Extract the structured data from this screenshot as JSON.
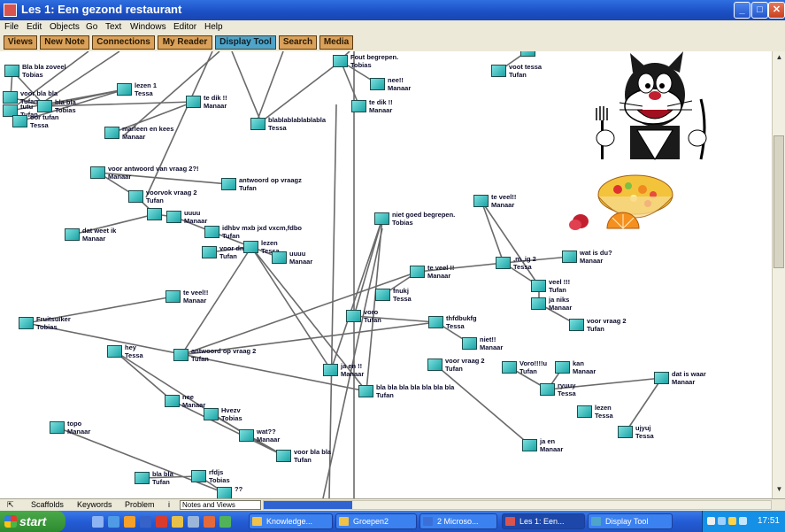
{
  "window": {
    "title": "Les 1: Een gezond restaurant",
    "buttons": {
      "minimize": "_",
      "maximize": "□",
      "close": "✕"
    }
  },
  "menu": [
    "File",
    "Edit",
    "Objects",
    "Go",
    "Text",
    "Windows",
    "Editor",
    "Help"
  ],
  "tools": [
    {
      "label": "Views",
      "active": false
    },
    {
      "label": "New Note",
      "active": false
    },
    {
      "label": "Connections",
      "active": false
    },
    {
      "label": "My Reader",
      "active": false
    },
    {
      "label": "Display Tool",
      "active": true
    },
    {
      "label": "Search",
      "active": false
    },
    {
      "label": "Media",
      "active": false
    }
  ],
  "notes": [
    {
      "id": "n1",
      "lines": [
        "Bla bla zoveel",
        "Tobias"
      ]
    },
    {
      "id": "n2",
      "lines": [
        "voor bla bla",
        "Tufan"
      ]
    },
    {
      "id": "n3",
      "lines": [
        "tutu",
        "Tufan"
      ]
    },
    {
      "id": "n4",
      "lines": [
        "bla bla",
        "Tobias"
      ]
    },
    {
      "id": "n5",
      "lines": [
        "oor tufan",
        "Tessa"
      ]
    },
    {
      "id": "n6",
      "lines": [
        "lezen 1",
        "Tessa"
      ]
    },
    {
      "id": "n7",
      "lines": [
        "te dik !!",
        "Manaar"
      ]
    },
    {
      "id": "n8",
      "lines": [
        "marleen en kees",
        "Manaar"
      ]
    },
    {
      "id": "n9",
      "lines": [
        "blablablablablabla",
        "Tessa"
      ]
    },
    {
      "id": "n10",
      "lines": [
        "Fout begrepen.",
        "Tobias"
      ]
    },
    {
      "id": "n11",
      "lines": [
        "nee!!",
        "Manaar"
      ]
    },
    {
      "id": "n12",
      "lines": [
        "te dik !!",
        "Manaar"
      ]
    },
    {
      "id": "n13",
      "lines": [
        "voot tessa",
        "Tufan"
      ]
    },
    {
      "id": "n14",
      "lines": [
        "",
        "Tessa"
      ]
    },
    {
      "id": "n15",
      "lines": [
        "voor antwoord van vraag 2?!",
        "Manaar"
      ]
    },
    {
      "id": "n16",
      "lines": [
        "antwoord op vraagz",
        "Tufan"
      ]
    },
    {
      "id": "n17",
      "lines": [
        "voorvok vraag 2",
        "Tufan"
      ]
    },
    {
      "id": "n18",
      "lines": [
        "dat weet ik",
        "Manaar"
      ]
    },
    {
      "id": "n19",
      "lines": [
        "",
        ""
      ]
    },
    {
      "id": "n20",
      "lines": [
        "uuuu",
        "Manaar"
      ]
    },
    {
      "id": "n21",
      "lines": [
        "idhbv mxb jxd vxcm,fdbo",
        "Tufan"
      ]
    },
    {
      "id": "n22",
      "lines": [
        "voor dm",
        "Tufan"
      ]
    },
    {
      "id": "n23",
      "lines": [
        "lezen",
        "Tessa"
      ]
    },
    {
      "id": "n24",
      "lines": [
        "uuuu",
        "Manaar"
      ]
    },
    {
      "id": "n25",
      "lines": [
        "niet goed begrepen.",
        "Tobias"
      ]
    },
    {
      "id": "n26",
      "lines": [
        "te veel!!",
        "Manaar"
      ]
    },
    {
      "id": "n27",
      "lines": [
        "wat is du?",
        "Manaar"
      ]
    },
    {
      "id": "n28",
      "lines": [
        ",m.,ig 2",
        "Tessa"
      ]
    },
    {
      "id": "n29",
      "lines": [
        "te veel !!",
        "Manaar"
      ]
    },
    {
      "id": "n30",
      "lines": [
        "veel !!!",
        "Tufan"
      ]
    },
    {
      "id": "n31",
      "lines": [
        "ja niks",
        "Manaar"
      ]
    },
    {
      "id": "n32",
      "lines": [
        "voor vraag 2",
        "Tufan"
      ]
    },
    {
      "id": "n33",
      "lines": [
        "te veel!!",
        "Manaar"
      ]
    },
    {
      "id": "n34",
      "lines": [
        "fnukj",
        "Tessa"
      ]
    },
    {
      "id": "n35",
      "lines": [
        "Fruitsuiker",
        "Tobias"
      ]
    },
    {
      "id": "n36",
      "lines": [
        "voro",
        "Tufan"
      ]
    },
    {
      "id": "n37",
      "lines": [
        "thfdbukfg",
        "Tessa"
      ]
    },
    {
      "id": "n38",
      "lines": [
        "niet!!",
        "Manaar"
      ]
    },
    {
      "id": "n39",
      "lines": [
        "hey",
        "Tessa"
      ]
    },
    {
      "id": "n40",
      "lines": [
        "antwoord op vraag 2",
        "Tufan"
      ]
    },
    {
      "id": "n41",
      "lines": [
        "voor vraag 2",
        "Tufan"
      ]
    },
    {
      "id": "n42",
      "lines": [
        "Voro!!!!u",
        "Tufan"
      ]
    },
    {
      "id": "n43",
      "lines": [
        "kan",
        "Manaar"
      ]
    },
    {
      "id": "n44",
      "lines": [
        "dat is waar",
        "Manaar"
      ]
    },
    {
      "id": "n45",
      "lines": [
        "ja  en !!",
        "Manaar"
      ]
    },
    {
      "id": "n46",
      "lines": [
        "bla bla bla bla bla bla bla",
        "Tufan"
      ]
    },
    {
      "id": "n47",
      "lines": [
        "ryuuy",
        "Tessa"
      ]
    },
    {
      "id": "n48",
      "lines": [
        "nee",
        "Manaar"
      ]
    },
    {
      "id": "n49",
      "lines": [
        "Hvezv",
        "Tobias"
      ]
    },
    {
      "id": "n50",
      "lines": [
        "lezen",
        "Tessa"
      ]
    },
    {
      "id": "n51",
      "lines": [
        "topo",
        "Manaar"
      ]
    },
    {
      "id": "n52",
      "lines": [
        "wat??",
        "Manaar"
      ]
    },
    {
      "id": "n53",
      "lines": [
        "ujyuj",
        "Tessa"
      ]
    },
    {
      "id": "n54",
      "lines": [
        "ja en",
        "Manaar"
      ]
    },
    {
      "id": "n55",
      "lines": [
        "voor bla bla",
        "Tufan"
      ]
    },
    {
      "id": "n56",
      "lines": [
        "bla bla",
        "Tufan"
      ]
    },
    {
      "id": "n57",
      "lines": [
        "rfdjs",
        "Tobias"
      ]
    },
    {
      "id": "n58",
      "lines": [
        "??",
        ""
      ]
    }
  ],
  "bottom_tabs": [
    "Scaffolds",
    "Keywords",
    "Problem",
    "i"
  ],
  "views_select": "Notes and Views",
  "taskbar": {
    "start": "start",
    "tasks": [
      {
        "label": "Knowledge...",
        "active": false
      },
      {
        "label": "Groepen2",
        "active": false
      },
      {
        "label": "2 Microso...",
        "active": false
      },
      {
        "label": "Les 1: Een...",
        "active": true
      },
      {
        "label": "Display Tool",
        "active": false
      }
    ],
    "clock": "17:51"
  },
  "colors": {
    "titlebar": "#1b4fc4",
    "tool_button": "#d9a15a",
    "tool_active": "#4ea4c9",
    "note": "#3fc4c4",
    "link": "#6a6a6a"
  }
}
